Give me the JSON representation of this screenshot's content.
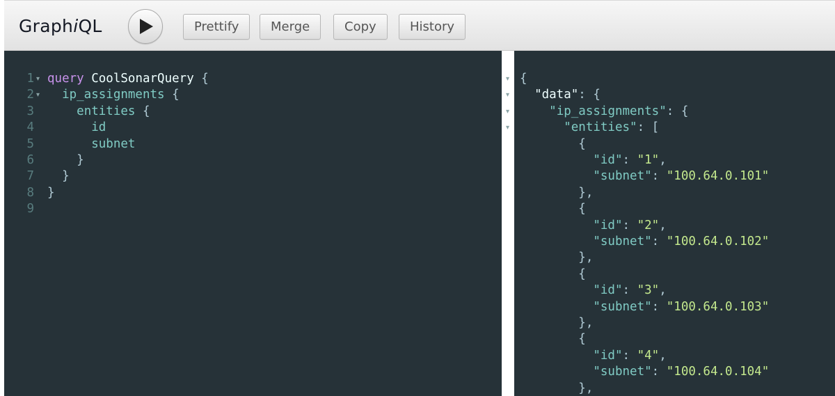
{
  "header": {
    "title_pre": "Graph",
    "title_i": "i",
    "title_post": "QL",
    "buttons": {
      "prettify": "Prettify",
      "merge": "Merge",
      "copy": "Copy",
      "history": "History"
    },
    "run_icon": "play-icon"
  },
  "query_editor": {
    "line_numbers": [
      "1",
      "2",
      "3",
      "4",
      "5",
      "6",
      "7",
      "8",
      "9"
    ],
    "lines": [
      {
        "indent": "",
        "keyword": "query",
        "name": "CoolSonarQuery",
        "punct": "{"
      },
      {
        "indent": "  ",
        "field": "ip_assignments",
        "punct": "{"
      },
      {
        "indent": "    ",
        "field": "entities",
        "punct": "{"
      },
      {
        "indent": "      ",
        "field": "id"
      },
      {
        "indent": "      ",
        "field": "subnet"
      },
      {
        "indent": "    ",
        "punct": "}"
      },
      {
        "indent": "  ",
        "punct": "}"
      },
      {
        "indent": "",
        "punct": "}"
      },
      {
        "indent": ""
      }
    ]
  },
  "result_viewer": {
    "lines": [
      "{",
      "  \"data\": {",
      "    \"ip_assignments\": {",
      "      \"entities\": [",
      "        {",
      "          \"id\": \"1\",",
      "          \"subnet\": \"100.64.0.101\"",
      "        },",
      "        {",
      "          \"id\": \"2\",",
      "          \"subnet\": \"100.64.0.102\"",
      "        },",
      "        {",
      "          \"id\": \"3\",",
      "          \"subnet\": \"100.64.0.103\"",
      "        },",
      "        {",
      "          \"id\": \"4\",",
      "          \"subnet\": \"100.64.0.104\"",
      "        },"
    ]
  },
  "colors": {
    "editor_bg": "#263238",
    "keyword": "#c792ea",
    "field": "#80cbc4",
    "string": "#c3e88d",
    "punctuation": "#b2ccd6",
    "line_number": "#587c7e"
  }
}
